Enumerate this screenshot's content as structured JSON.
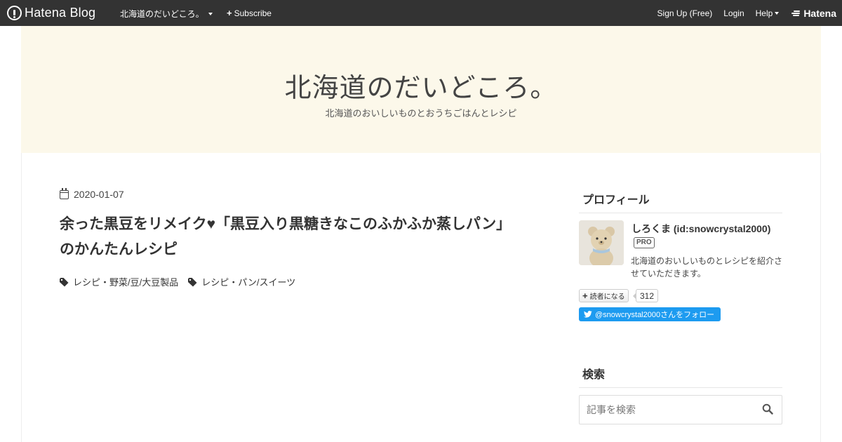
{
  "globalbar": {
    "logo_text": "Hatena Blog",
    "blog_name": "北海道のだいどころ。",
    "subscribe": "Subscribe",
    "signup": "Sign Up (Free)",
    "login": "Login",
    "help": "Help",
    "hatena": "Hatena"
  },
  "header": {
    "title": "北海道のだいどころ。",
    "description": "北海道のおいしいものとおうちごはんとレシピ"
  },
  "entry": {
    "date": "2020-01-07",
    "title": "余った黒豆をリメイク♥「黒豆入り黒糖きなこのふかふか蒸しパン」のかんたんレシピ",
    "categories": [
      "レシピ・野菜/豆/大豆製品",
      "レシピ・パン/スイーツ"
    ]
  },
  "sidebar": {
    "profile_heading": "プロフィール",
    "profile_name": "しろくま (id:snowcrystal2000)",
    "pro_badge": "PRO",
    "profile_desc": "北海道のおいしいものとレシピを紹介させていただきます。",
    "reader_button": "読者になる",
    "reader_count": "312",
    "twitter_follow": "@snowcrystal2000さんをフォロー",
    "search_heading": "検索",
    "search_placeholder": "記事を検索"
  },
  "colors": {
    "globalbar_bg": "#333333",
    "header_bg": "#fcf8ea",
    "twitter_blue": "#1d9bf0"
  }
}
